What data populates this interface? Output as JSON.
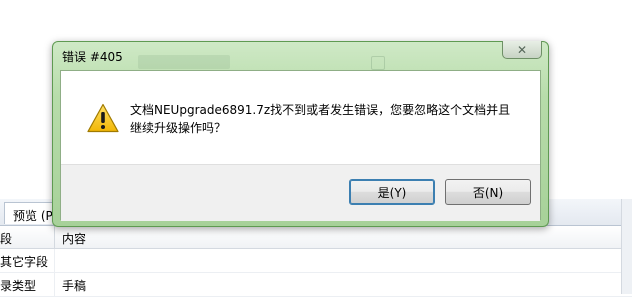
{
  "background": {
    "tab_label": "预览 (P",
    "headers": [
      "段",
      "内容"
    ],
    "rows": [
      [
        "其它字段",
        ""
      ],
      [
        "录类型",
        "手稿"
      ]
    ]
  },
  "dialog": {
    "title": "错误 #405",
    "close_glyph": "✕",
    "message_line1": "文档NEUpgrade6891.7z找不到或者发生错误，您要忽略这个文档并且",
    "message_line2": "继续升级操作吗？",
    "yes_label": "是(Y)",
    "no_label": "否(N)",
    "icon": "warning-icon"
  }
}
